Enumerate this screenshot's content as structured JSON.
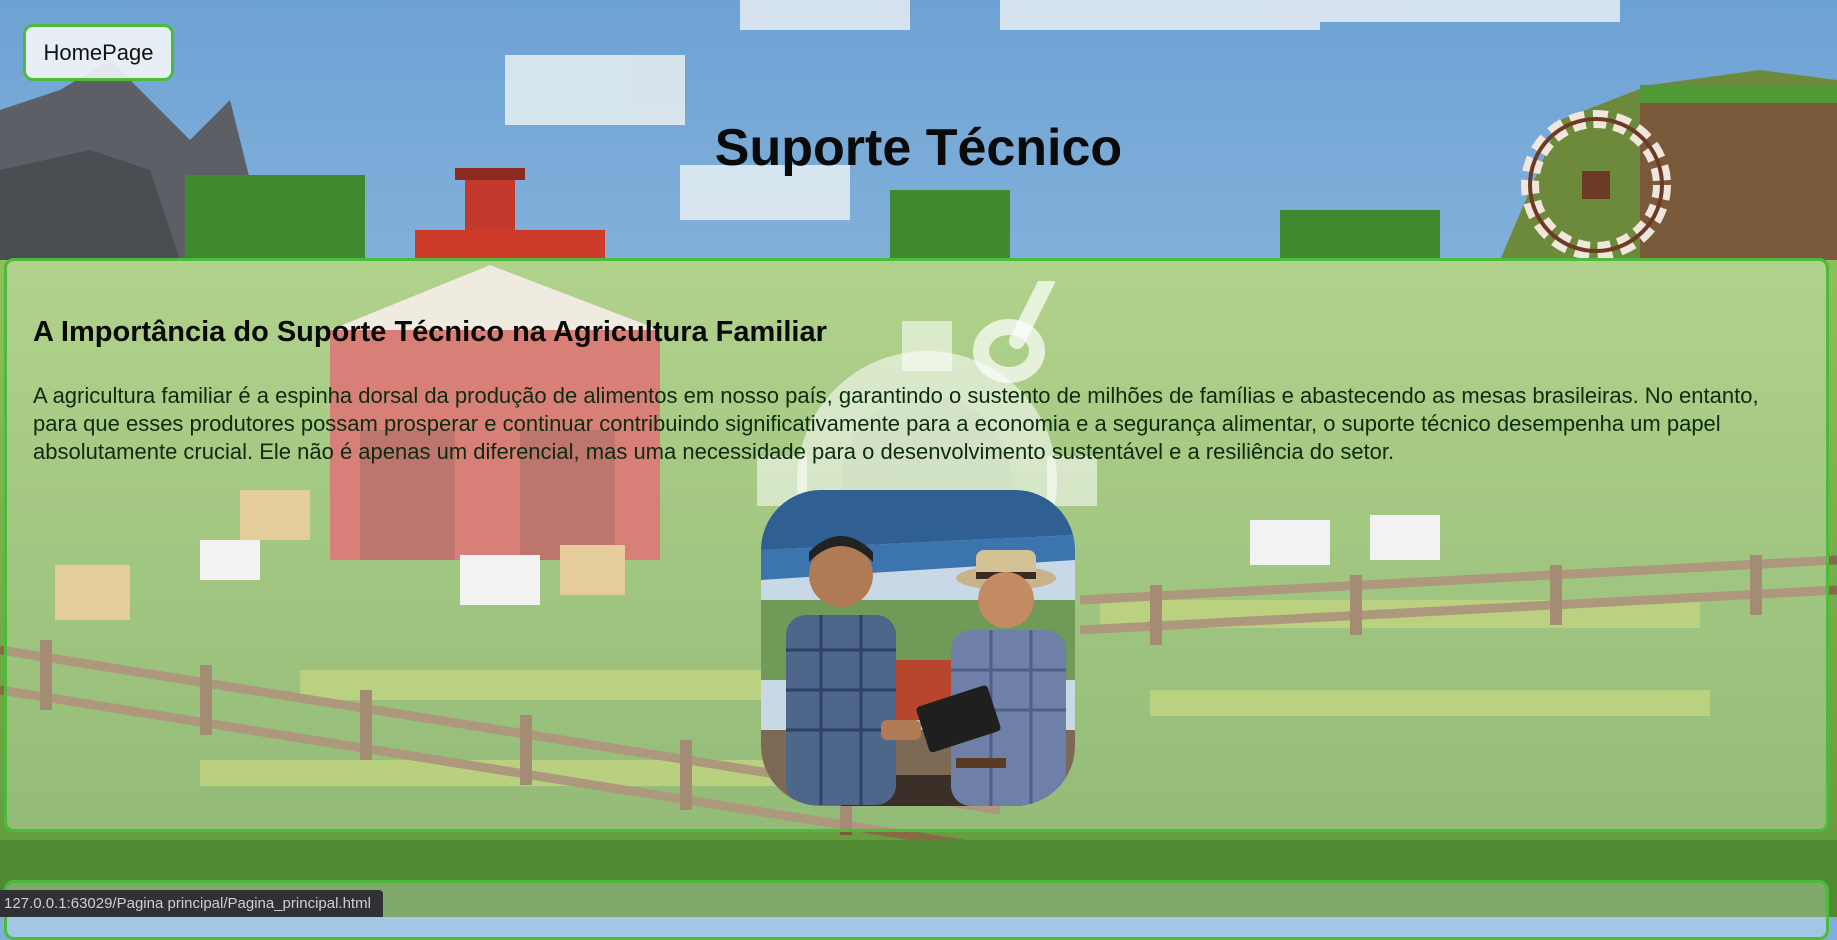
{
  "nav": {
    "home_label": "HomePage"
  },
  "header": {
    "title": "Suporte Técnico"
  },
  "section": {
    "heading": "A Importância do Suporte Técnico na Agricultura Familiar",
    "paragraph": "A agricultura familiar é a espinha dorsal da produção de alimentos em nosso país, garantindo o sustento de milhões de famílias e abastecendo as mesas brasileiras. No entanto, para que esses produtores possam prosperar e continuar contribuindo significativamente para a economia e a segurança alimentar, o suporte técnico desempenha um papel absolutamente crucial. Ele não é apenas um diferencial, mas uma necessidade para o desenvolvimento sustentável e a resiliência do setor."
  },
  "status_bar": {
    "url": "127.0.0.1:63029/Pagina principal/Pagina_principal.html"
  },
  "icons": {
    "background": "blocky-farm-scene",
    "watermark": "gear-shovel-icon",
    "photo": "farmers-consultation-photo"
  },
  "colors": {
    "accent_border": "#4cbb3c",
    "sky": "#7fb0d8",
    "grass": "#6ea64a",
    "text_dark": "#0a0a0a",
    "status_bg": "#2f3134"
  }
}
